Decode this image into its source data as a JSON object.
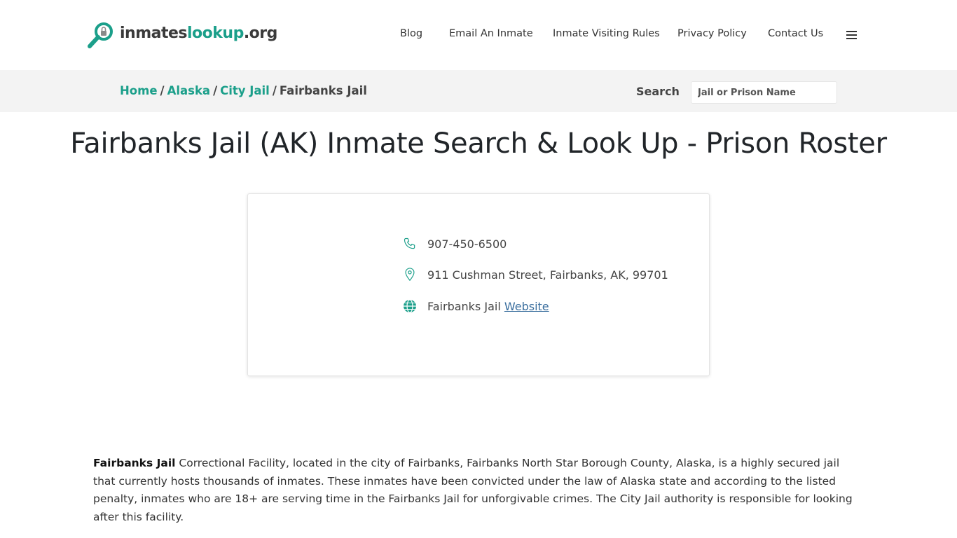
{
  "logo": {
    "part1": "inmates",
    "part2": "lookup",
    "part3": ".org"
  },
  "nav": {
    "items": [
      {
        "label": "Blog"
      },
      {
        "label": "Email An Inmate"
      },
      {
        "label": "Inmate Visiting Rules"
      },
      {
        "label": "Privacy Policy"
      },
      {
        "label": "Contact Us"
      }
    ],
    "menu_icon": "hamburger-icon"
  },
  "breadcrumb": {
    "items": [
      "Home",
      "Alaska",
      "City Jail"
    ],
    "separator": "/",
    "current": "Fairbanks Jail"
  },
  "search": {
    "label": "Search",
    "placeholder": "Jail or Prison Name",
    "value": ""
  },
  "title": "Fairbanks Jail (AK) Inmate Search & Look Up - Prison Roster",
  "contact": {
    "phone": "907-450-6500",
    "address": "911 Cushman Street, Fairbanks, AK, 99701",
    "website_prefix": "Fairbanks Jail",
    "website_link": "Website"
  },
  "description": {
    "bold": "Fairbanks Jail",
    "text": " Correctional Facility, located in the city of Fairbanks, Fairbanks North Star Borough County, Alaska, is a highly secured jail that currently hosts thousands of inmates. These inmates have been convicted under the law of Alaska state and according to the listed penalty, inmates who are 18+ are serving time in the Fairbanks Jail for unforgivable crimes. The City Jail authority is responsible for looking after this facility."
  },
  "colors": {
    "accent": "#1b9f8a",
    "link": "#3a6e9e",
    "bar": "#f3f3f3"
  }
}
